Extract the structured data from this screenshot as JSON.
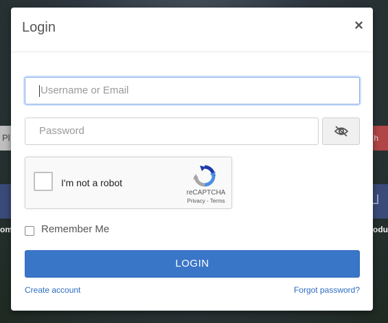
{
  "background": {
    "left_strip_text": "Pl",
    "right_strip_text": "h",
    "left_band_text": "om",
    "right_band_text": "odu"
  },
  "modal": {
    "title": "Login",
    "close_glyph": "×"
  },
  "form": {
    "username_placeholder": "Username or Email",
    "password_placeholder": "Password",
    "password_toggle_icon": "eye-slash-icon",
    "remember_label": "Remember Me",
    "login_label": "LOGIN"
  },
  "captcha": {
    "label": "I'm not a robot",
    "brand": "reCAPTCHA",
    "links": "Privacy - Terms"
  },
  "links": {
    "create_account": "Create account",
    "forgot_password": "Forgot password?"
  },
  "colors": {
    "primary": "#3a76c8",
    "link": "#2d6cc0",
    "focus": "#8ab0e6"
  }
}
